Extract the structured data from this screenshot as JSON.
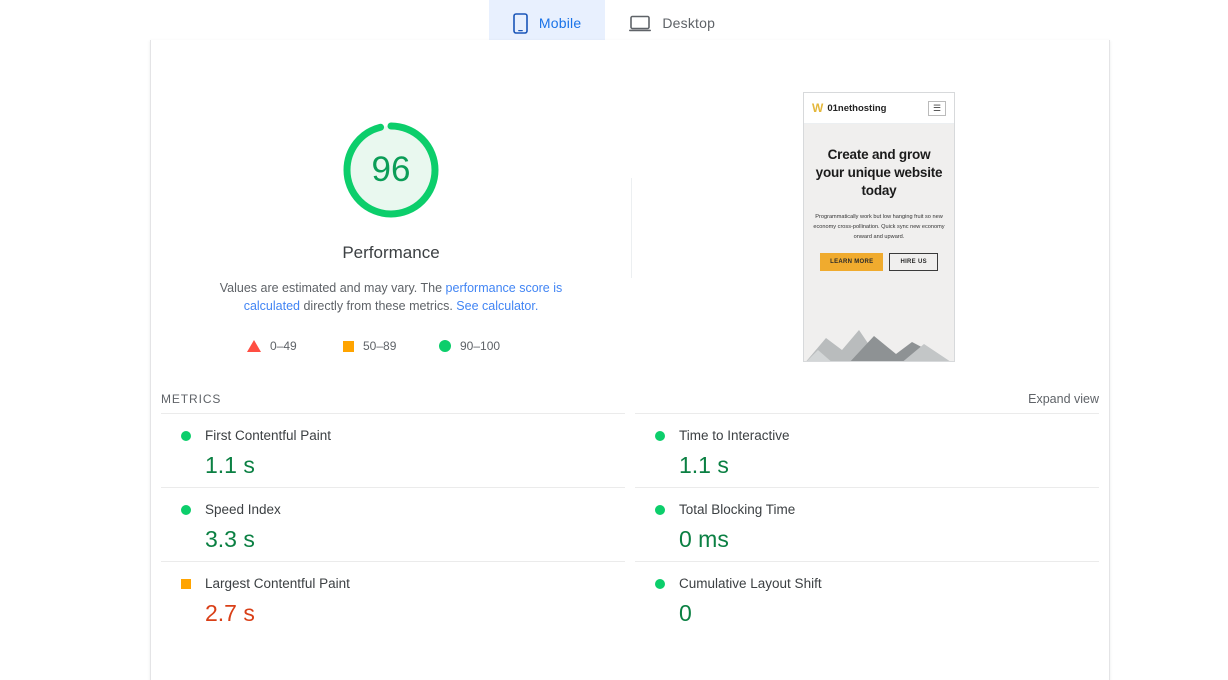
{
  "tabs": [
    {
      "label": "Mobile",
      "icon": "mobile-phone-icon",
      "active": true
    },
    {
      "label": "Desktop",
      "icon": "laptop-icon",
      "active": false
    }
  ],
  "score": {
    "value": "96",
    "label": "Performance",
    "percent": 96,
    "color": "#0cce6b"
  },
  "disclaimer": {
    "text_1": "Values are estimated and may vary. The ",
    "link_1": "performance score is calculated",
    "text_2": " directly from these metrics. ",
    "link_2": "See calculator.",
    "link_color": "#4285f4"
  },
  "legend": [
    {
      "icon": "red-triangle-icon",
      "range": "0–49",
      "color": "#ff4e42"
    },
    {
      "icon": "orange-square-icon",
      "range": "50–89",
      "color": "#ffa400"
    },
    {
      "icon": "green-circle-icon",
      "range": "90–100",
      "color": "#0cce6b"
    }
  ],
  "thumbnail": {
    "brand": "01nethosting",
    "logo": "W",
    "menu_icon": "hamburger-menu-icon",
    "headline": "Create and grow your unique website today",
    "paragraph": "Programmatically work but low hanging fruit so new economy cross-pollination. Quick sync new economy onward and upward.",
    "primary_button": "LEARN MORE",
    "secondary_button": "HIRE US"
  },
  "metrics_section": {
    "title": "METRICS",
    "expand_label": "Expand view"
  },
  "metrics": {
    "left": [
      {
        "name": "First Contentful Paint",
        "value": "1.1 s",
        "rating": "good",
        "icon": "green-circle-icon"
      },
      {
        "name": "Speed Index",
        "value": "3.3 s",
        "rating": "good",
        "icon": "green-circle-icon"
      },
      {
        "name": "Largest Contentful Paint",
        "value": "2.7 s",
        "rating": "average",
        "icon": "orange-square-icon"
      }
    ],
    "right": [
      {
        "name": "Time to Interactive",
        "value": "1.1 s",
        "rating": "good",
        "icon": "green-circle-icon"
      },
      {
        "name": "Total Blocking Time",
        "value": "0 ms",
        "rating": "good",
        "icon": "green-circle-icon"
      },
      {
        "name": "Cumulative Layout Shift",
        "value": "0",
        "rating": "good",
        "icon": "green-circle-icon"
      }
    ]
  }
}
